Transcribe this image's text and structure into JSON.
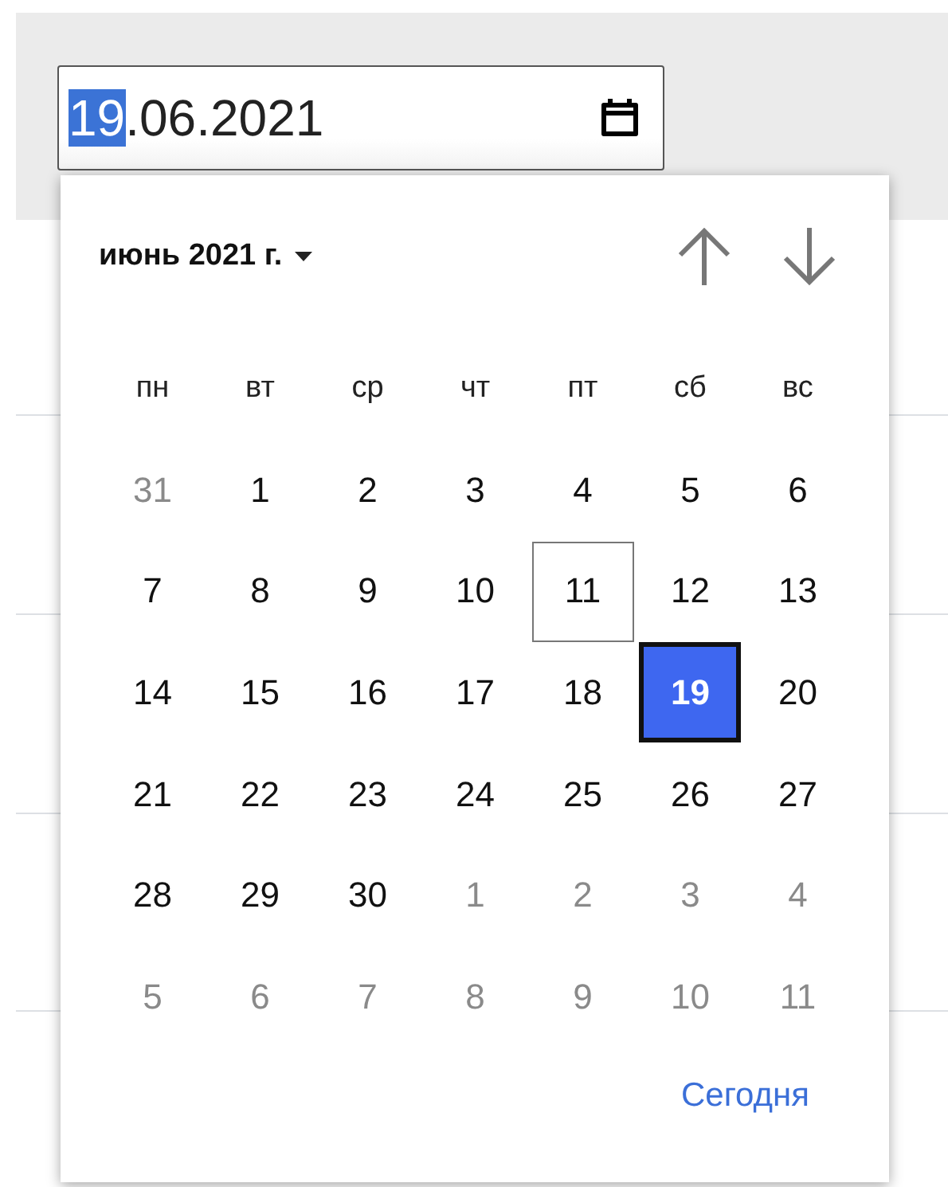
{
  "date_field": {
    "value_selected": "19",
    "value_rest": ".06.2021"
  },
  "calendar": {
    "month_label": "июнь 2021 г.",
    "weekdays": [
      "пн",
      "вт",
      "ср",
      "чт",
      "пт",
      "сб",
      "вс"
    ],
    "days": [
      {
        "label": "31",
        "muted": true,
        "today": false,
        "selected": false
      },
      {
        "label": "1",
        "muted": false,
        "today": false,
        "selected": false
      },
      {
        "label": "2",
        "muted": false,
        "today": false,
        "selected": false
      },
      {
        "label": "3",
        "muted": false,
        "today": false,
        "selected": false
      },
      {
        "label": "4",
        "muted": false,
        "today": false,
        "selected": false
      },
      {
        "label": "5",
        "muted": false,
        "today": false,
        "selected": false
      },
      {
        "label": "6",
        "muted": false,
        "today": false,
        "selected": false
      },
      {
        "label": "7",
        "muted": false,
        "today": false,
        "selected": false
      },
      {
        "label": "8",
        "muted": false,
        "today": false,
        "selected": false
      },
      {
        "label": "9",
        "muted": false,
        "today": false,
        "selected": false
      },
      {
        "label": "10",
        "muted": false,
        "today": false,
        "selected": false
      },
      {
        "label": "11",
        "muted": false,
        "today": true,
        "selected": false
      },
      {
        "label": "12",
        "muted": false,
        "today": false,
        "selected": false
      },
      {
        "label": "13",
        "muted": false,
        "today": false,
        "selected": false
      },
      {
        "label": "14",
        "muted": false,
        "today": false,
        "selected": false
      },
      {
        "label": "15",
        "muted": false,
        "today": false,
        "selected": false
      },
      {
        "label": "16",
        "muted": false,
        "today": false,
        "selected": false
      },
      {
        "label": "17",
        "muted": false,
        "today": false,
        "selected": false
      },
      {
        "label": "18",
        "muted": false,
        "today": false,
        "selected": false
      },
      {
        "label": "19",
        "muted": false,
        "today": false,
        "selected": true
      },
      {
        "label": "20",
        "muted": false,
        "today": false,
        "selected": false
      },
      {
        "label": "21",
        "muted": false,
        "today": false,
        "selected": false
      },
      {
        "label": "22",
        "muted": false,
        "today": false,
        "selected": false
      },
      {
        "label": "23",
        "muted": false,
        "today": false,
        "selected": false
      },
      {
        "label": "24",
        "muted": false,
        "today": false,
        "selected": false
      },
      {
        "label": "25",
        "muted": false,
        "today": false,
        "selected": false
      },
      {
        "label": "26",
        "muted": false,
        "today": false,
        "selected": false
      },
      {
        "label": "27",
        "muted": false,
        "today": false,
        "selected": false
      },
      {
        "label": "28",
        "muted": false,
        "today": false,
        "selected": false
      },
      {
        "label": "29",
        "muted": false,
        "today": false,
        "selected": false
      },
      {
        "label": "30",
        "muted": false,
        "today": false,
        "selected": false
      },
      {
        "label": "1",
        "muted": true,
        "today": false,
        "selected": false
      },
      {
        "label": "2",
        "muted": true,
        "today": false,
        "selected": false
      },
      {
        "label": "3",
        "muted": true,
        "today": false,
        "selected": false
      },
      {
        "label": "4",
        "muted": true,
        "today": false,
        "selected": false
      },
      {
        "label": "5",
        "muted": true,
        "today": false,
        "selected": false
      },
      {
        "label": "6",
        "muted": true,
        "today": false,
        "selected": false
      },
      {
        "label": "7",
        "muted": true,
        "today": false,
        "selected": false
      },
      {
        "label": "8",
        "muted": true,
        "today": false,
        "selected": false
      },
      {
        "label": "9",
        "muted": true,
        "today": false,
        "selected": false
      },
      {
        "label": "10",
        "muted": true,
        "today": false,
        "selected": false
      },
      {
        "label": "11",
        "muted": true,
        "today": false,
        "selected": false
      }
    ],
    "today_link": "Сегодня"
  }
}
